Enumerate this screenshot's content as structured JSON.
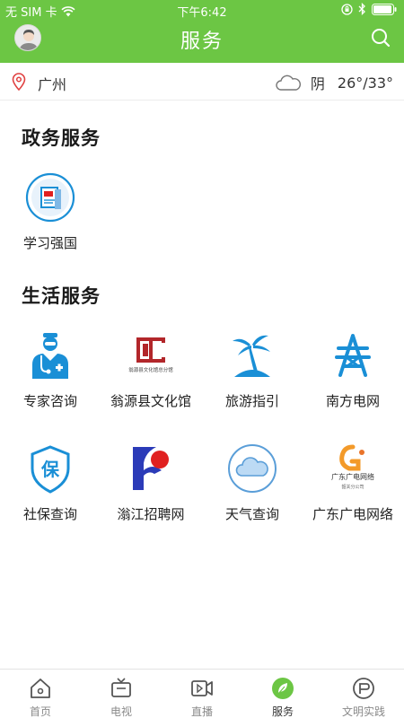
{
  "status_bar": {
    "carrier": "无 SIM 卡",
    "time": "下午6:42"
  },
  "header": {
    "title": "服务"
  },
  "location": {
    "city": "广州",
    "weather_condition": "阴",
    "temperature": "26°/33°"
  },
  "sections": {
    "government": {
      "title": "政务服务",
      "items": [
        {
          "label": "学习强国",
          "icon": "study-book-icon"
        }
      ]
    },
    "life": {
      "title": "生活服务",
      "items": [
        {
          "label": "专家咨询",
          "icon": "doctor-icon"
        },
        {
          "label": "翁源县文化馆",
          "icon": "culture-hall-logo-icon"
        },
        {
          "label": "旅游指引",
          "icon": "palm-tree-icon"
        },
        {
          "label": "南方电网",
          "icon": "power-grid-icon"
        },
        {
          "label": "社保查询",
          "icon": "social-security-icon"
        },
        {
          "label": "滃江招聘网",
          "icon": "recruitment-logo-icon"
        },
        {
          "label": "天气查询",
          "icon": "cloud-icon"
        },
        {
          "label": "广东广电网络",
          "icon": "gd-cable-logo-icon"
        }
      ]
    }
  },
  "logo_text": {
    "culture_hall": "翁源县文化馆总分馆",
    "gd_cable": "广东广电网络",
    "gd_cable_sub": "韶关分公司"
  },
  "tabs": [
    {
      "label": "首页",
      "icon": "home-icon"
    },
    {
      "label": "电视",
      "icon": "tv-icon"
    },
    {
      "label": "直播",
      "icon": "live-video-icon"
    },
    {
      "label": "服务",
      "icon": "service-leaf-icon",
      "active": true
    },
    {
      "label": "文明实践",
      "icon": "civilization-icon"
    }
  ],
  "colors": {
    "brand_green": "#6cc644",
    "icon_blue": "#1a8fd6",
    "logo_red": "#e02020"
  }
}
